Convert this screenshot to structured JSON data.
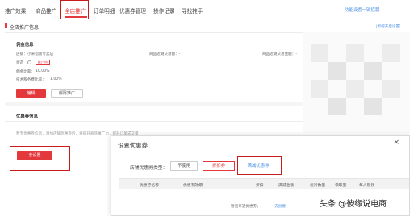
{
  "nav": {
    "tabs": [
      {
        "label": "推广效果"
      },
      {
        "label": "商品推广"
      },
      {
        "label": "全店推广"
      },
      {
        "label": "订单明细"
      },
      {
        "label": "优惠券管理"
      },
      {
        "label": "操作记录"
      },
      {
        "label": "寻找推手"
      }
    ],
    "active_index": 2,
    "right_link": "功能设置一键招募"
  },
  "breadcrumb": {
    "title": "全店推广信息",
    "right_link": "|如何开启设置"
  },
  "commission": {
    "section_title": "佣金信息",
    "shop_label": "店铺：",
    "shop_value": "小米指南专卖店",
    "recent_a_label": "商品近期交易额：-",
    "recent_b_label": "商品近期交易金额：-",
    "status_label": "状态 ",
    "status_badge": "推广中",
    "rate_label": "佣金比率：",
    "rate_value": "10.00%",
    "service_label": "技术服务费比率：",
    "service_value": "1.00%",
    "edit_button": "编辑",
    "stop_button": "解除推广"
  },
  "coupon_section": {
    "title": "优惠券信息",
    "hint": "暂无优惠券信息，添加店铺优惠券后，将提升商品推广力，提升订单成交量",
    "set_button": "去设置"
  },
  "modal": {
    "title": "设置优惠券",
    "close_icon": "×",
    "type_label": "店铺优惠券类型：",
    "options": [
      {
        "label": "不使用"
      },
      {
        "label": "折扣券"
      },
      {
        "label": "满减优惠券"
      }
    ],
    "selected_index": 1,
    "table_headers": [
      "优惠券名称",
      "优惠有效期",
      "折扣",
      "满减金额",
      "发行数量",
      "领取量",
      "每人限领"
    ],
    "empty_text": "暂无可选优惠券，",
    "empty_link": "去创建"
  },
  "colors": {
    "accent": "#e4393c",
    "link": "#4a90e2",
    "highlight_frame": "#c81c1c"
  },
  "watermark": "头条 @彼缘说电商"
}
